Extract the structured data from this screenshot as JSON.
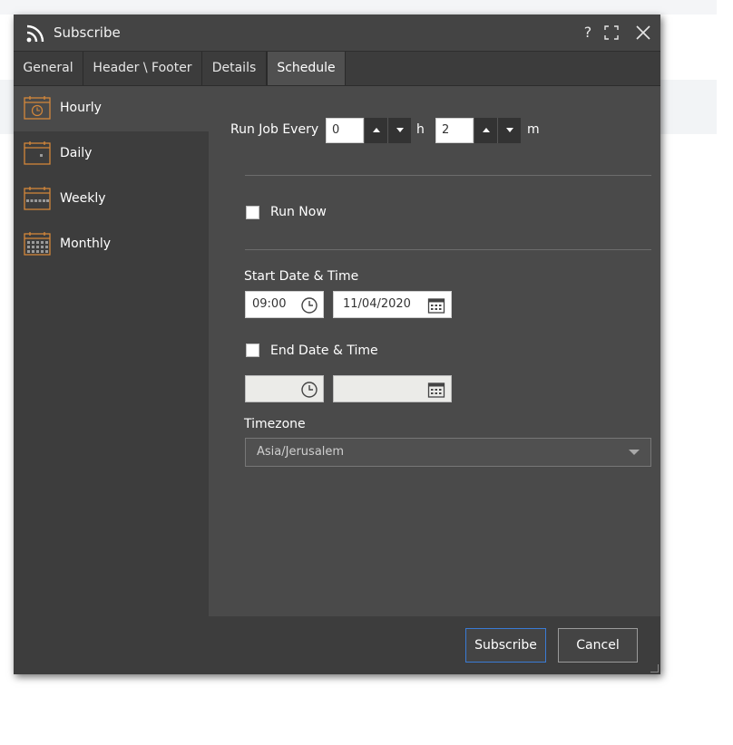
{
  "dialog": {
    "title": "Subscribe",
    "help_label": "?",
    "colors": {
      "accent_button_border": "#3a7bd5",
      "calendar_icon": "#d4873a",
      "dialog_bg": "#4a4a4a"
    }
  },
  "tabs": [
    {
      "label": "General",
      "active": false
    },
    {
      "label": "Header \\ Footer",
      "active": false
    },
    {
      "label": "Details",
      "active": false
    },
    {
      "label": "Schedule",
      "active": true
    }
  ],
  "sidebar": {
    "items": [
      {
        "label": "Hourly",
        "icon": "calendar-clock-icon",
        "active": true
      },
      {
        "label": "Daily",
        "icon": "calendar-day-icon",
        "active": false
      },
      {
        "label": "Weekly",
        "icon": "calendar-week-icon",
        "active": false
      },
      {
        "label": "Monthly",
        "icon": "calendar-month-icon",
        "active": false
      }
    ]
  },
  "schedule": {
    "run_every_label": "Run Job Every",
    "hours_value": "0",
    "hours_unit": "h",
    "minutes_value": "2",
    "minutes_unit": "m",
    "run_now_label": "Run Now",
    "run_now_checked": false,
    "start_label": "Start Date & Time",
    "start_time": "09:00",
    "start_date": "11/04/2020",
    "end_label": "End Date & Time",
    "end_checked": false,
    "end_time": "",
    "end_date": "",
    "timezone_label": "Timezone",
    "timezone_value": "Asia/Jerusalem"
  },
  "footer": {
    "subscribe_label": "Subscribe",
    "cancel_label": "Cancel"
  }
}
